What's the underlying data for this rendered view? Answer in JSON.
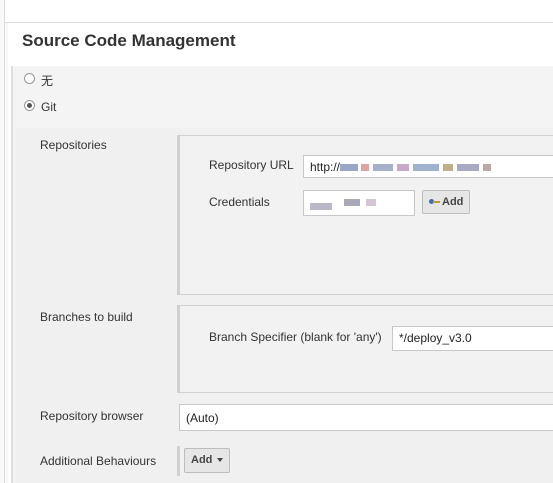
{
  "section": {
    "title": "Source Code Management"
  },
  "scm_options": [
    {
      "label": "无",
      "selected": false
    },
    {
      "label": "Git",
      "selected": true
    }
  ],
  "repositories": {
    "label": "Repositories",
    "url_label": "Repository URL",
    "url_value": "http://",
    "credentials_label": "Credentials",
    "add_button": "Add",
    "key_icon": "key-icon"
  },
  "branches": {
    "label": "Branches to build",
    "specifier_label": "Branch Specifier (blank for 'any')",
    "specifier_value": "*/deploy_v3.0"
  },
  "browser": {
    "label": "Repository browser",
    "value": "(Auto)"
  },
  "behaviours": {
    "label": "Additional Behaviours",
    "add_button": "Add"
  }
}
